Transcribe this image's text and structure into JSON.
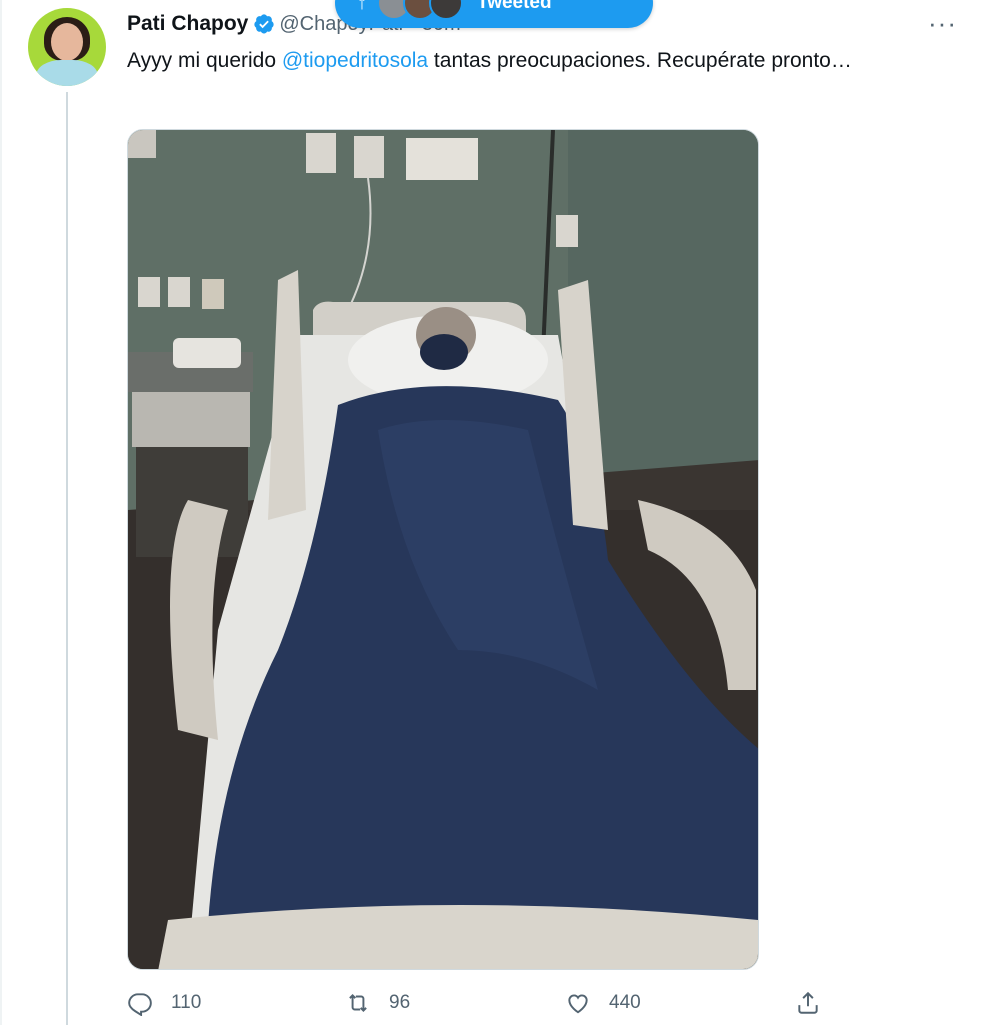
{
  "tweet": {
    "author_name": "Pati Chapoy",
    "handle": "@ChapoyPati",
    "separator": "·",
    "time": "30m",
    "text_before": "Ayyy mi querido ",
    "mention": "@tiopedritosola",
    "text_after": " tantas preocupaciones. Recupérate pronto…",
    "more_menu": "···"
  },
  "new_tweets_pill": {
    "arrow": "↑",
    "label": "Tweeted"
  },
  "actions": {
    "replies": "110",
    "retweets": "96",
    "likes": "440"
  },
  "colors": {
    "accent": "#1d9bf0",
    "text": "#0f1419",
    "muted": "#536471"
  },
  "icons": [
    "verified-badge-icon",
    "more-icon",
    "reply-icon",
    "retweet-icon",
    "like-icon",
    "share-icon"
  ]
}
